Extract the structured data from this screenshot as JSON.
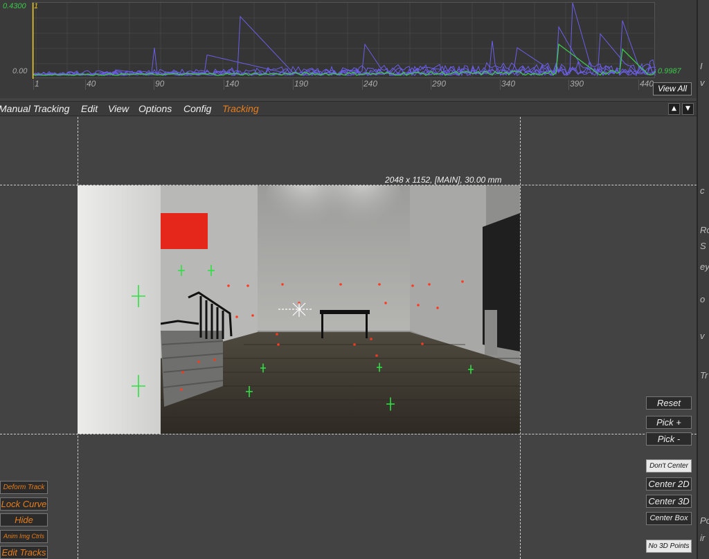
{
  "graph": {
    "y_max_label": "0.4300",
    "y_min_label": "0.00",
    "cursor_label": "1",
    "right_value": "0.9987",
    "x_ticks": [
      "1",
      "40",
      "90",
      "140",
      "190",
      "240",
      "290",
      "340",
      "390",
      "440"
    ],
    "view_all_label": "View All"
  },
  "menu": {
    "items": [
      "Manual Tracking",
      "Edit",
      "View",
      "Options",
      "Config",
      "Tracking"
    ],
    "active": "Tracking",
    "up_arrow": "▲",
    "down_arrow": "▼"
  },
  "viewport": {
    "image_info": "2048 x 1152, [MAIN], 30.00 mm"
  },
  "right_buttons": {
    "reset": "Reset",
    "pick_plus": "Pick +",
    "pick_minus": "Pick -",
    "dont_center": "Don't Center",
    "center_2d": "Center 2D",
    "center_3d": "Center 3D",
    "center_box": "Center Box",
    "no_3d_points": "No 3D Points"
  },
  "left_buttons": {
    "deform_track": "Deform Track",
    "lock_curve": "Lock Curve",
    "hide": "Hide",
    "anim_img_ctrls": "Anim Img Ctrls",
    "edit_tracks": "Edit Tracks"
  },
  "right_strip_chars": [
    "I",
    "v",
    "c",
    "Ro",
    "S",
    "ey",
    "o",
    "v",
    "Tr",
    "Po",
    "ir"
  ],
  "colors": {
    "accent_orange": "#e87e1c",
    "graph_yellow": "#e6c21c",
    "graph_green": "#3cc84a",
    "graph_purple": "#6b5fe8",
    "tracker_red": "#ff3a1e",
    "tracker_green": "#2ee043"
  }
}
